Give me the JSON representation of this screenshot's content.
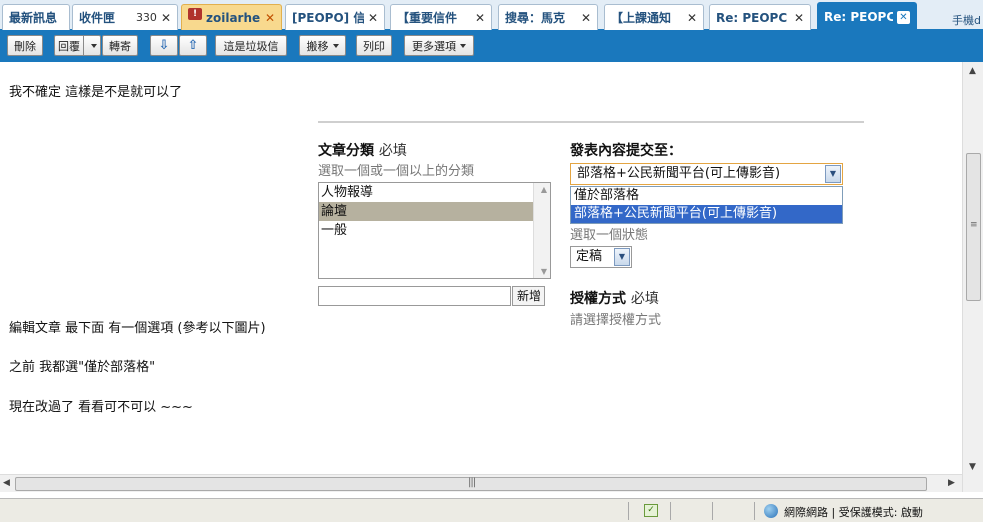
{
  "tabs": [
    {
      "label": "最新訊息",
      "closable": false
    },
    {
      "label": "收件匣",
      "count": "330",
      "closable": true
    },
    {
      "label": "zoilarhe",
      "closable": true,
      "warning": true,
      "warning_glyph": "!"
    },
    {
      "label": "[PEOPO] 信",
      "closable": true
    },
    {
      "label": "【重要信件",
      "closable": true
    },
    {
      "label": "搜尋：馬克",
      "closable": true
    },
    {
      "label": "【上課通知",
      "closable": true
    },
    {
      "label": "Re: PEOPC",
      "closable": true
    },
    {
      "label": "Re: PEOPC",
      "closable": true,
      "active": true
    }
  ],
  "tab_close_glyph": "✕",
  "tabbar_edge_text": "手機d",
  "toolbar": {
    "delete": "刪除",
    "reply": "回覆",
    "forward": "轉寄",
    "prev_glyph": "⇩",
    "next_glyph": "⇧",
    "spam": "這是垃圾信",
    "move": "搬移",
    "print": "列印",
    "more": "更多選項"
  },
  "message": {
    "line1": "我不確定 這樣是不是就可以了",
    "line2": "編輯文章 最下面 有一個選項 (參考以下圖片)",
    "line3": "之前 我都選\"僅於部落格\"",
    "line4": "現在改過了 看看可不可以 ~~~"
  },
  "embedded": {
    "category": {
      "label": "文章分類",
      "required": "必填",
      "hint": "選取一個或一個以上的分類",
      "options": [
        "人物報導",
        "論壇",
        "一般"
      ],
      "selected_index": 1,
      "add_button": "新增"
    },
    "submit_to": {
      "label": "發表內容提交至：",
      "selected": "部落格+公民新聞平台(可上傳影音)",
      "options": [
        "僅於部落格",
        "部落格+公民新聞平台(可上傳影音)"
      ],
      "highlighted_index": 1,
      "status_hint": "選取一個狀態",
      "status_value": "定稿"
    },
    "license": {
      "label": "授權方式",
      "required": "必填",
      "hint": "請選擇授權方式"
    }
  },
  "statusbar": {
    "zone": "網際網路 | 受保護模式: 啟動"
  }
}
